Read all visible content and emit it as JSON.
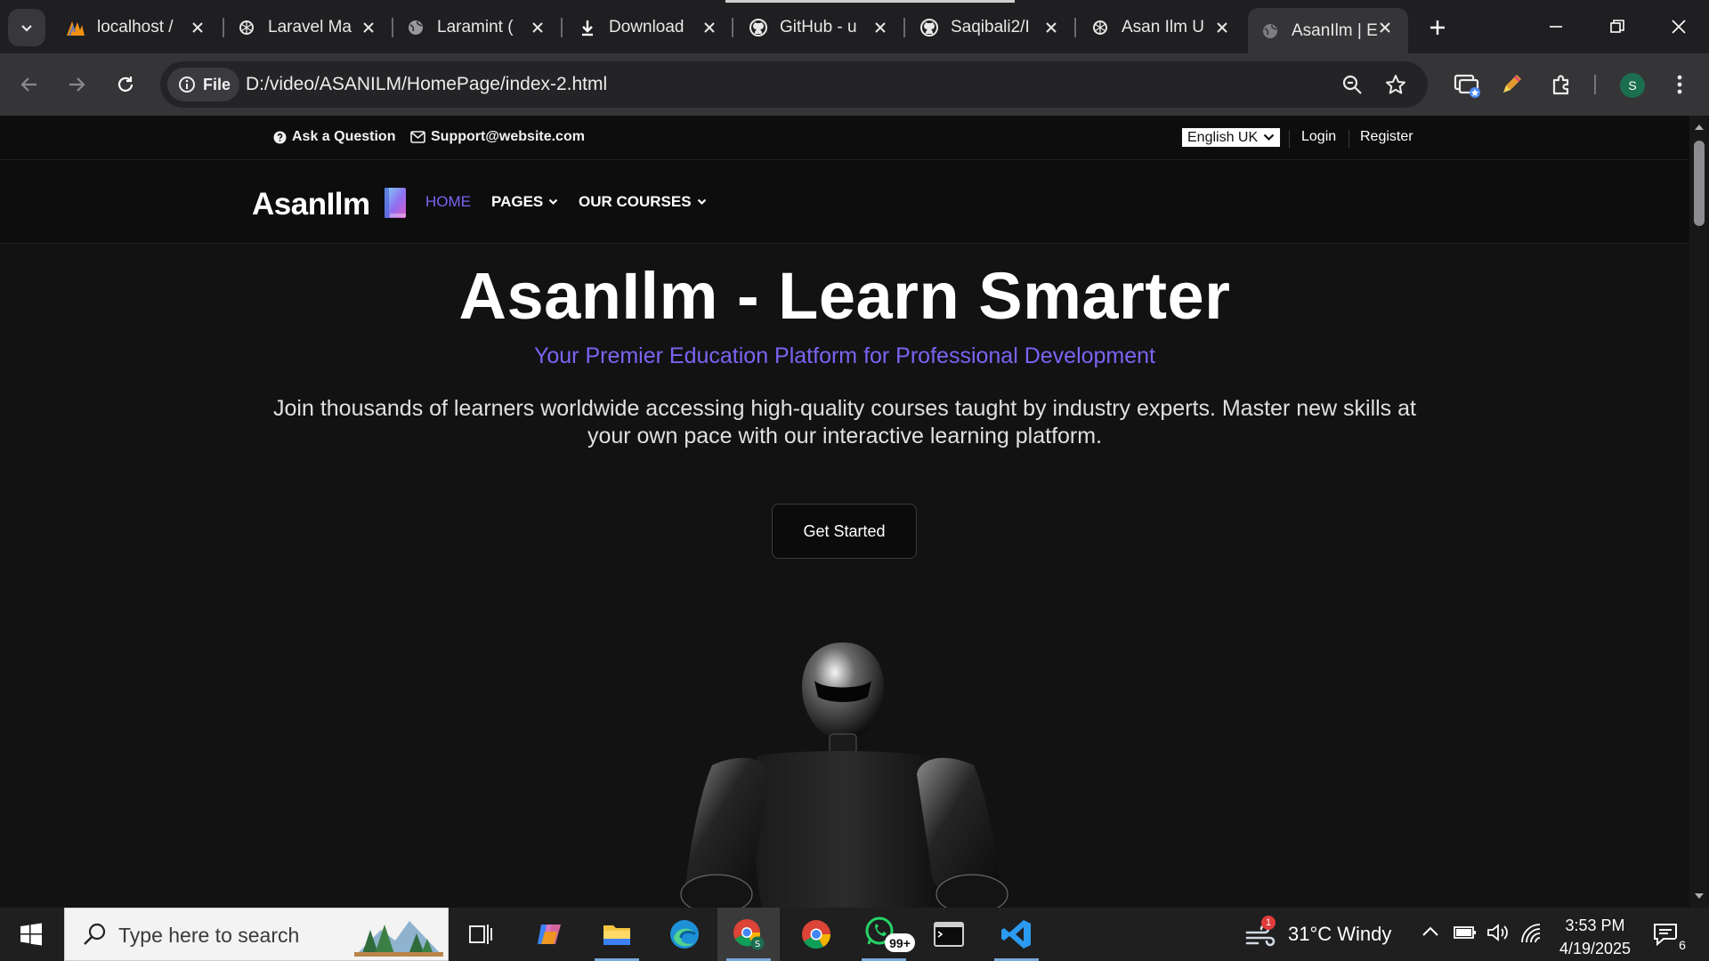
{
  "browser": {
    "tabs": [
      {
        "title": "localhost /",
        "icon": "phpmyadmin-icon"
      },
      {
        "title": "Laravel Ma",
        "icon": "openai-icon"
      },
      {
        "title": "Laramint (",
        "icon": "globe-icon"
      },
      {
        "title": "Download",
        "icon": "download-icon"
      },
      {
        "title": "GitHub - u",
        "icon": "github-icon"
      },
      {
        "title": "Saqibali2/I",
        "icon": "github-icon"
      },
      {
        "title": "Asan Ilm U",
        "icon": "openai-icon"
      },
      {
        "title": "AsanIlm | E",
        "icon": "globe-icon",
        "active": true
      }
    ],
    "chip_label": "File",
    "url": "D:/video/ASANILM/HomePage/index-2.html",
    "profile_initial": "S"
  },
  "page": {
    "topbar": {
      "ask": "Ask a Question",
      "email": "Support@website.com",
      "language": "English UK",
      "login": "Login",
      "register": "Register"
    },
    "nav": {
      "logo": "AsanIlm",
      "home": "HOME",
      "pages": "PAGES",
      "courses": "OUR COURSES"
    },
    "hero": {
      "title": "AsanIlm - Learn Smarter",
      "subtitle": "Your Premier Education Platform for Professional Development",
      "description": "Join thousands of learners worldwide accessing high-quality courses taught by industry experts. Master new skills at your own pace with our interactive learning platform.",
      "cta": "Get Started"
    },
    "colors": {
      "accent": "#7b64f2",
      "background": "#121213"
    }
  },
  "taskbar": {
    "search_placeholder": "Type here to search",
    "whatsapp_badge": "99+",
    "weather": "31°C  Windy",
    "weather_alert": "1",
    "time": "3:53 PM",
    "date": "4/19/2025",
    "notifications": "6"
  }
}
